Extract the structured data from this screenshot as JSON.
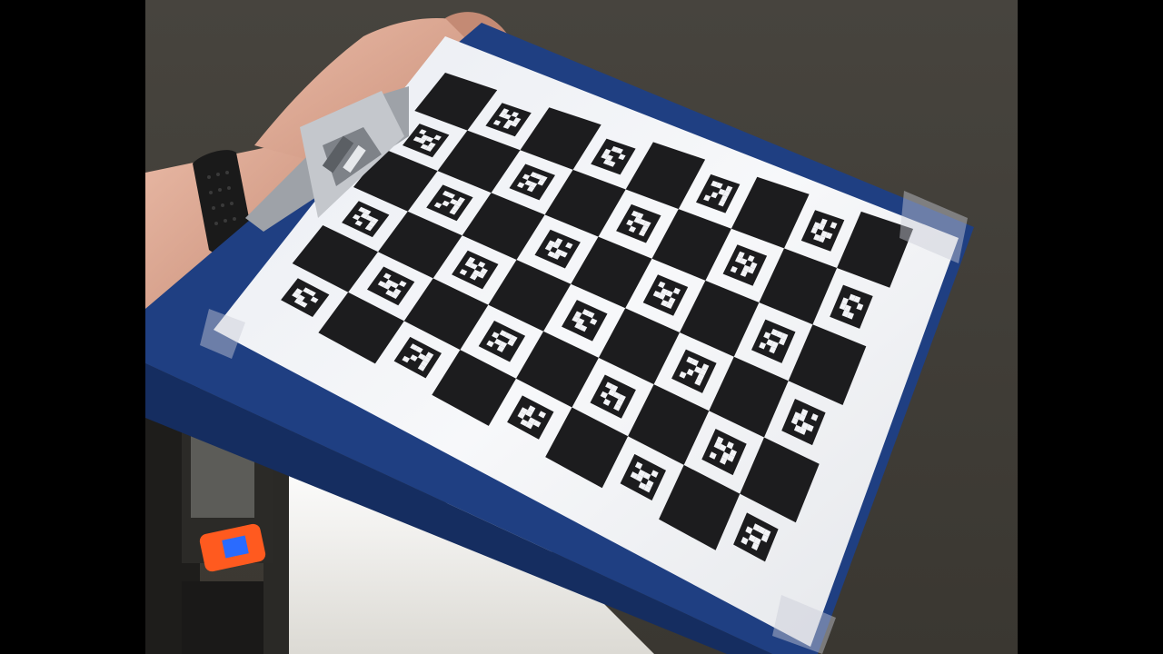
{
  "scene": {
    "description_kind": "photo",
    "board": {
      "rows": 6,
      "cols": 9,
      "marker_patterns": [
        [
          1,
          0,
          1,
          0,
          1,
          1,
          0,
          1,
          0,
          0,
          1,
          1,
          1,
          0,
          1,
          0
        ],
        [
          0,
          1,
          1,
          0,
          1,
          0,
          0,
          1,
          1,
          1,
          0,
          0,
          0,
          1,
          1,
          0
        ],
        [
          1,
          1,
          0,
          1,
          0,
          0,
          1,
          1,
          0,
          1,
          0,
          1,
          1,
          0,
          0,
          1
        ],
        [
          0,
          1,
          0,
          1,
          1,
          1,
          0,
          0,
          1,
          0,
          1,
          1,
          0,
          1,
          1,
          0
        ],
        [
          1,
          0,
          0,
          1,
          0,
          1,
          1,
          0,
          1,
          1,
          0,
          1,
          0,
          0,
          1,
          1
        ],
        [
          0,
          1,
          1,
          1,
          1,
          0,
          0,
          1,
          0,
          1,
          1,
          0,
          1,
          0,
          1,
          0
        ],
        [
          1,
          1,
          0,
          0,
          0,
          1,
          1,
          1,
          1,
          0,
          0,
          1,
          0,
          1,
          0,
          1
        ]
      ]
    },
    "colors": {
      "wall": "#4a4640",
      "wall_dark": "#36332e",
      "clipboard": "#1f3f82",
      "clipboard_edge": "#152d60",
      "paper": "#f2f3f6",
      "square": "#1c1c1e",
      "skin": "#d9a48f",
      "strap": "#1a1a1a",
      "clip": "#b9bcc2",
      "led": "#2a6bff",
      "led_frame": "#ff5a1f",
      "window": "#f1f0ec"
    }
  }
}
